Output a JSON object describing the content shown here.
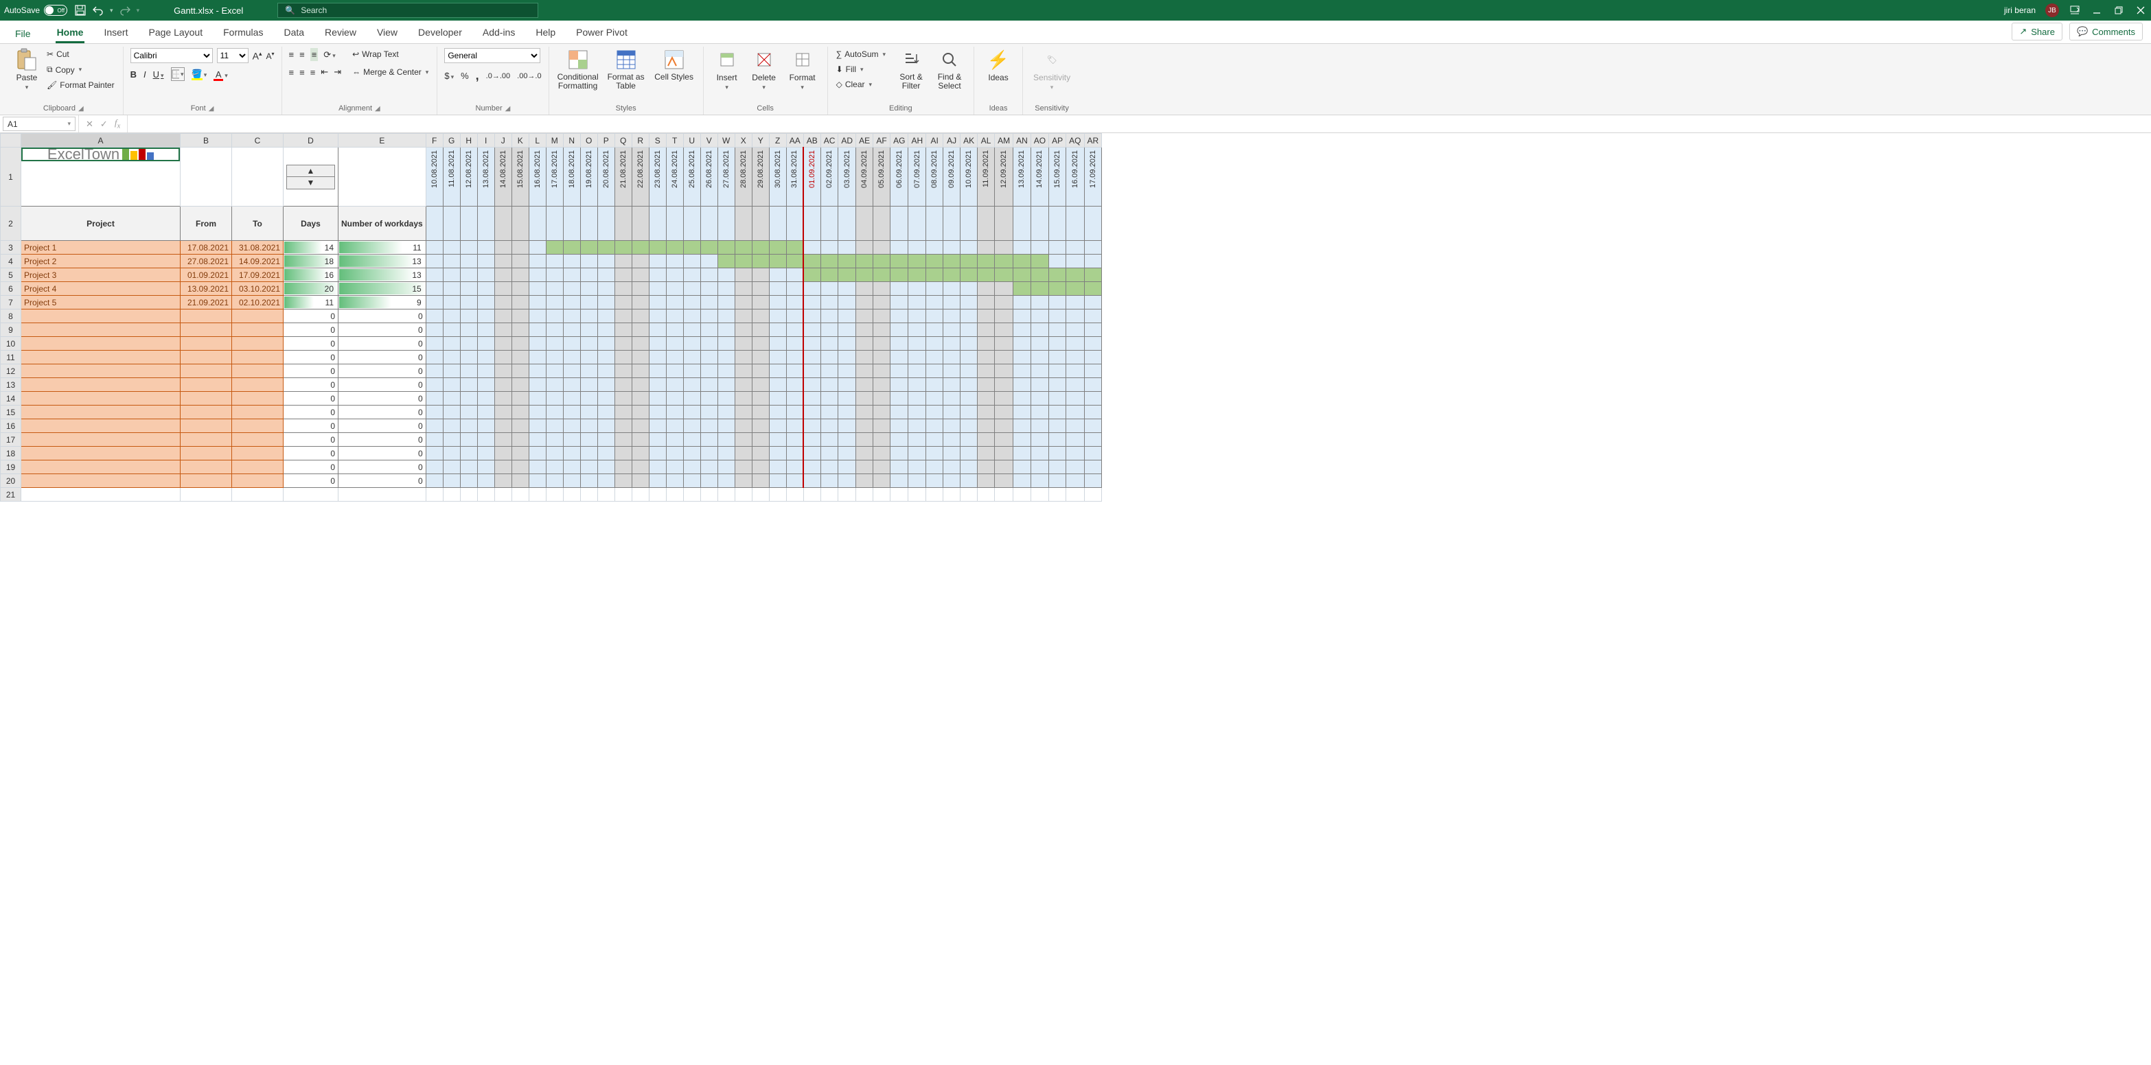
{
  "titlebar": {
    "autosave": "AutoSave",
    "autosave_state": "Off",
    "filename": "Gantt.xlsx  -  Excel",
    "search_placeholder": "Search",
    "user": "jiri beran",
    "user_initials": "JB"
  },
  "tabs": {
    "file": "File",
    "list": [
      "Home",
      "Insert",
      "Page Layout",
      "Formulas",
      "Data",
      "Review",
      "View",
      "Developer",
      "Add-ins",
      "Help",
      "Power Pivot"
    ],
    "active": "Home",
    "share": "Share",
    "comments": "Comments"
  },
  "ribbon": {
    "clipboard": {
      "paste": "Paste",
      "cut": "Cut",
      "copy": "Copy",
      "painter": "Format Painter",
      "label": "Clipboard"
    },
    "font": {
      "name": "Calibri",
      "size": "11",
      "label": "Font"
    },
    "alignment": {
      "wrap": "Wrap Text",
      "merge": "Merge & Center",
      "label": "Alignment"
    },
    "number": {
      "format": "General",
      "label": "Number"
    },
    "styles": {
      "cond": "Conditional Formatting",
      "table": "Format as Table",
      "cell": "Cell Styles",
      "label": "Styles"
    },
    "cells": {
      "insert": "Insert",
      "delete": "Delete",
      "format": "Format",
      "label": "Cells"
    },
    "editing": {
      "autosum": "AutoSum",
      "fill": "Fill",
      "clear": "Clear",
      "sort": "Sort & Filter",
      "find": "Find & Select",
      "label": "Editing"
    },
    "ideas": {
      "btn": "Ideas",
      "label": "Ideas"
    },
    "sens": {
      "btn": "Sensitivity",
      "label": "Sensitivity"
    }
  },
  "formulabar": {
    "ref": "A1"
  },
  "sheet": {
    "col_letters": [
      "A",
      "B",
      "C",
      "D",
      "E",
      "F",
      "G",
      "H",
      "I",
      "J",
      "K",
      "L",
      "M",
      "N",
      "O",
      "P",
      "Q",
      "R",
      "S",
      "T",
      "U",
      "V",
      "W",
      "X",
      "Y",
      "Z",
      "AA",
      "AB",
      "AC",
      "AD",
      "AE",
      "AF",
      "AG",
      "AH",
      "AI",
      "AJ",
      "AK",
      "AL",
      "AM",
      "AN",
      "AO",
      "AP",
      "AQ",
      "AR"
    ],
    "logo": "ExcelTown",
    "headers": {
      "project": "Project",
      "from": "From",
      "to": "To",
      "days": "Days",
      "workdays": "Number of workdays"
    },
    "dates": [
      "10.08.2021",
      "11.08.2021",
      "12.08.2021",
      "13.08.2021",
      "14.08.2021",
      "15.08.2021",
      "16.08.2021",
      "17.08.2021",
      "18.08.2021",
      "19.08.2021",
      "20.08.2021",
      "21.08.2021",
      "22.08.2021",
      "23.08.2021",
      "24.08.2021",
      "25.08.2021",
      "26.08.2021",
      "27.08.2021",
      "28.08.2021",
      "29.08.2021",
      "30.08.2021",
      "31.08.2021",
      "01.09.2021",
      "02.09.2021",
      "03.09.2021",
      "04.09.2021",
      "05.09.2021",
      "06.09.2021",
      "07.09.2021",
      "08.09.2021",
      "09.09.2021",
      "10.09.2021",
      "11.09.2021",
      "12.09.2021",
      "13.09.2021",
      "14.09.2021",
      "15.09.2021",
      "16.09.2021",
      "17.09.2021"
    ],
    "weekend_idx": [
      4,
      5,
      11,
      12,
      18,
      19,
      25,
      26,
      32,
      33
    ],
    "today_idx": 22,
    "rows": [
      {
        "name": "Project 1",
        "from": "17.08.2021",
        "to": "31.08.2021",
        "days": 14,
        "wd": 11,
        "gstart": 7,
        "gend": 21
      },
      {
        "name": "Project 2",
        "from": "27.08.2021",
        "to": "14.09.2021",
        "days": 18,
        "wd": 13,
        "gstart": 17,
        "gend": 35
      },
      {
        "name": "Project 3",
        "from": "01.09.2021",
        "to": "17.09.2021",
        "days": 16,
        "wd": 13,
        "gstart": 22,
        "gend": 38
      },
      {
        "name": "Project 4",
        "from": "13.09.2021",
        "to": "03.10.2021",
        "days": 20,
        "wd": 15,
        "gstart": 34,
        "gend": 38
      },
      {
        "name": "Project 5",
        "from": "21.09.2021",
        "to": "02.10.2021",
        "days": 11,
        "wd": 9,
        "gstart": 99,
        "gend": 99
      }
    ],
    "max_days": 20,
    "max_wd": 15,
    "empty_rows": 13
  }
}
